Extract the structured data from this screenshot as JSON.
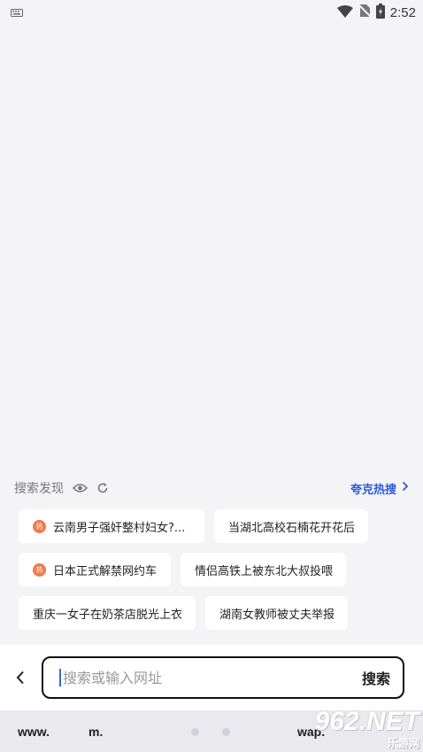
{
  "status_bar": {
    "time": "2:52",
    "icons": [
      "keyboard-icon",
      "wifi-icon",
      "no-sim-icon",
      "battery-charging-icon"
    ]
  },
  "discover": {
    "title": "搜索发现",
    "hot_link": "夸克热搜",
    "chips": [
      {
        "text": "云南男子强奸整村妇女?...",
        "hot": true,
        "hot_badge": "热"
      },
      {
        "text": "当湖北高校石楠花开花后",
        "hot": false
      },
      {
        "text": "日本正式解禁网约车",
        "hot": true,
        "hot_badge": "热"
      },
      {
        "text": "情侣高铁上被东北大叔投喂",
        "hot": false
      },
      {
        "text": "重庆一女子在奶茶店脱光上衣",
        "hot": false
      },
      {
        "text": "湖南女教师被丈夫举报",
        "hot": false
      }
    ]
  },
  "search": {
    "placeholder": "搜索或输入网址",
    "value": "",
    "submit_label": "搜索"
  },
  "shortcuts": {
    "www": "www.",
    "m": "m.",
    "wap": "wap."
  },
  "watermark": {
    "main": "962.NET",
    "sub": "乐游网"
  },
  "colors": {
    "accent": "#2a5bd7",
    "hot_badge": "#ef7b4d",
    "background": "#f4f4f6"
  }
}
